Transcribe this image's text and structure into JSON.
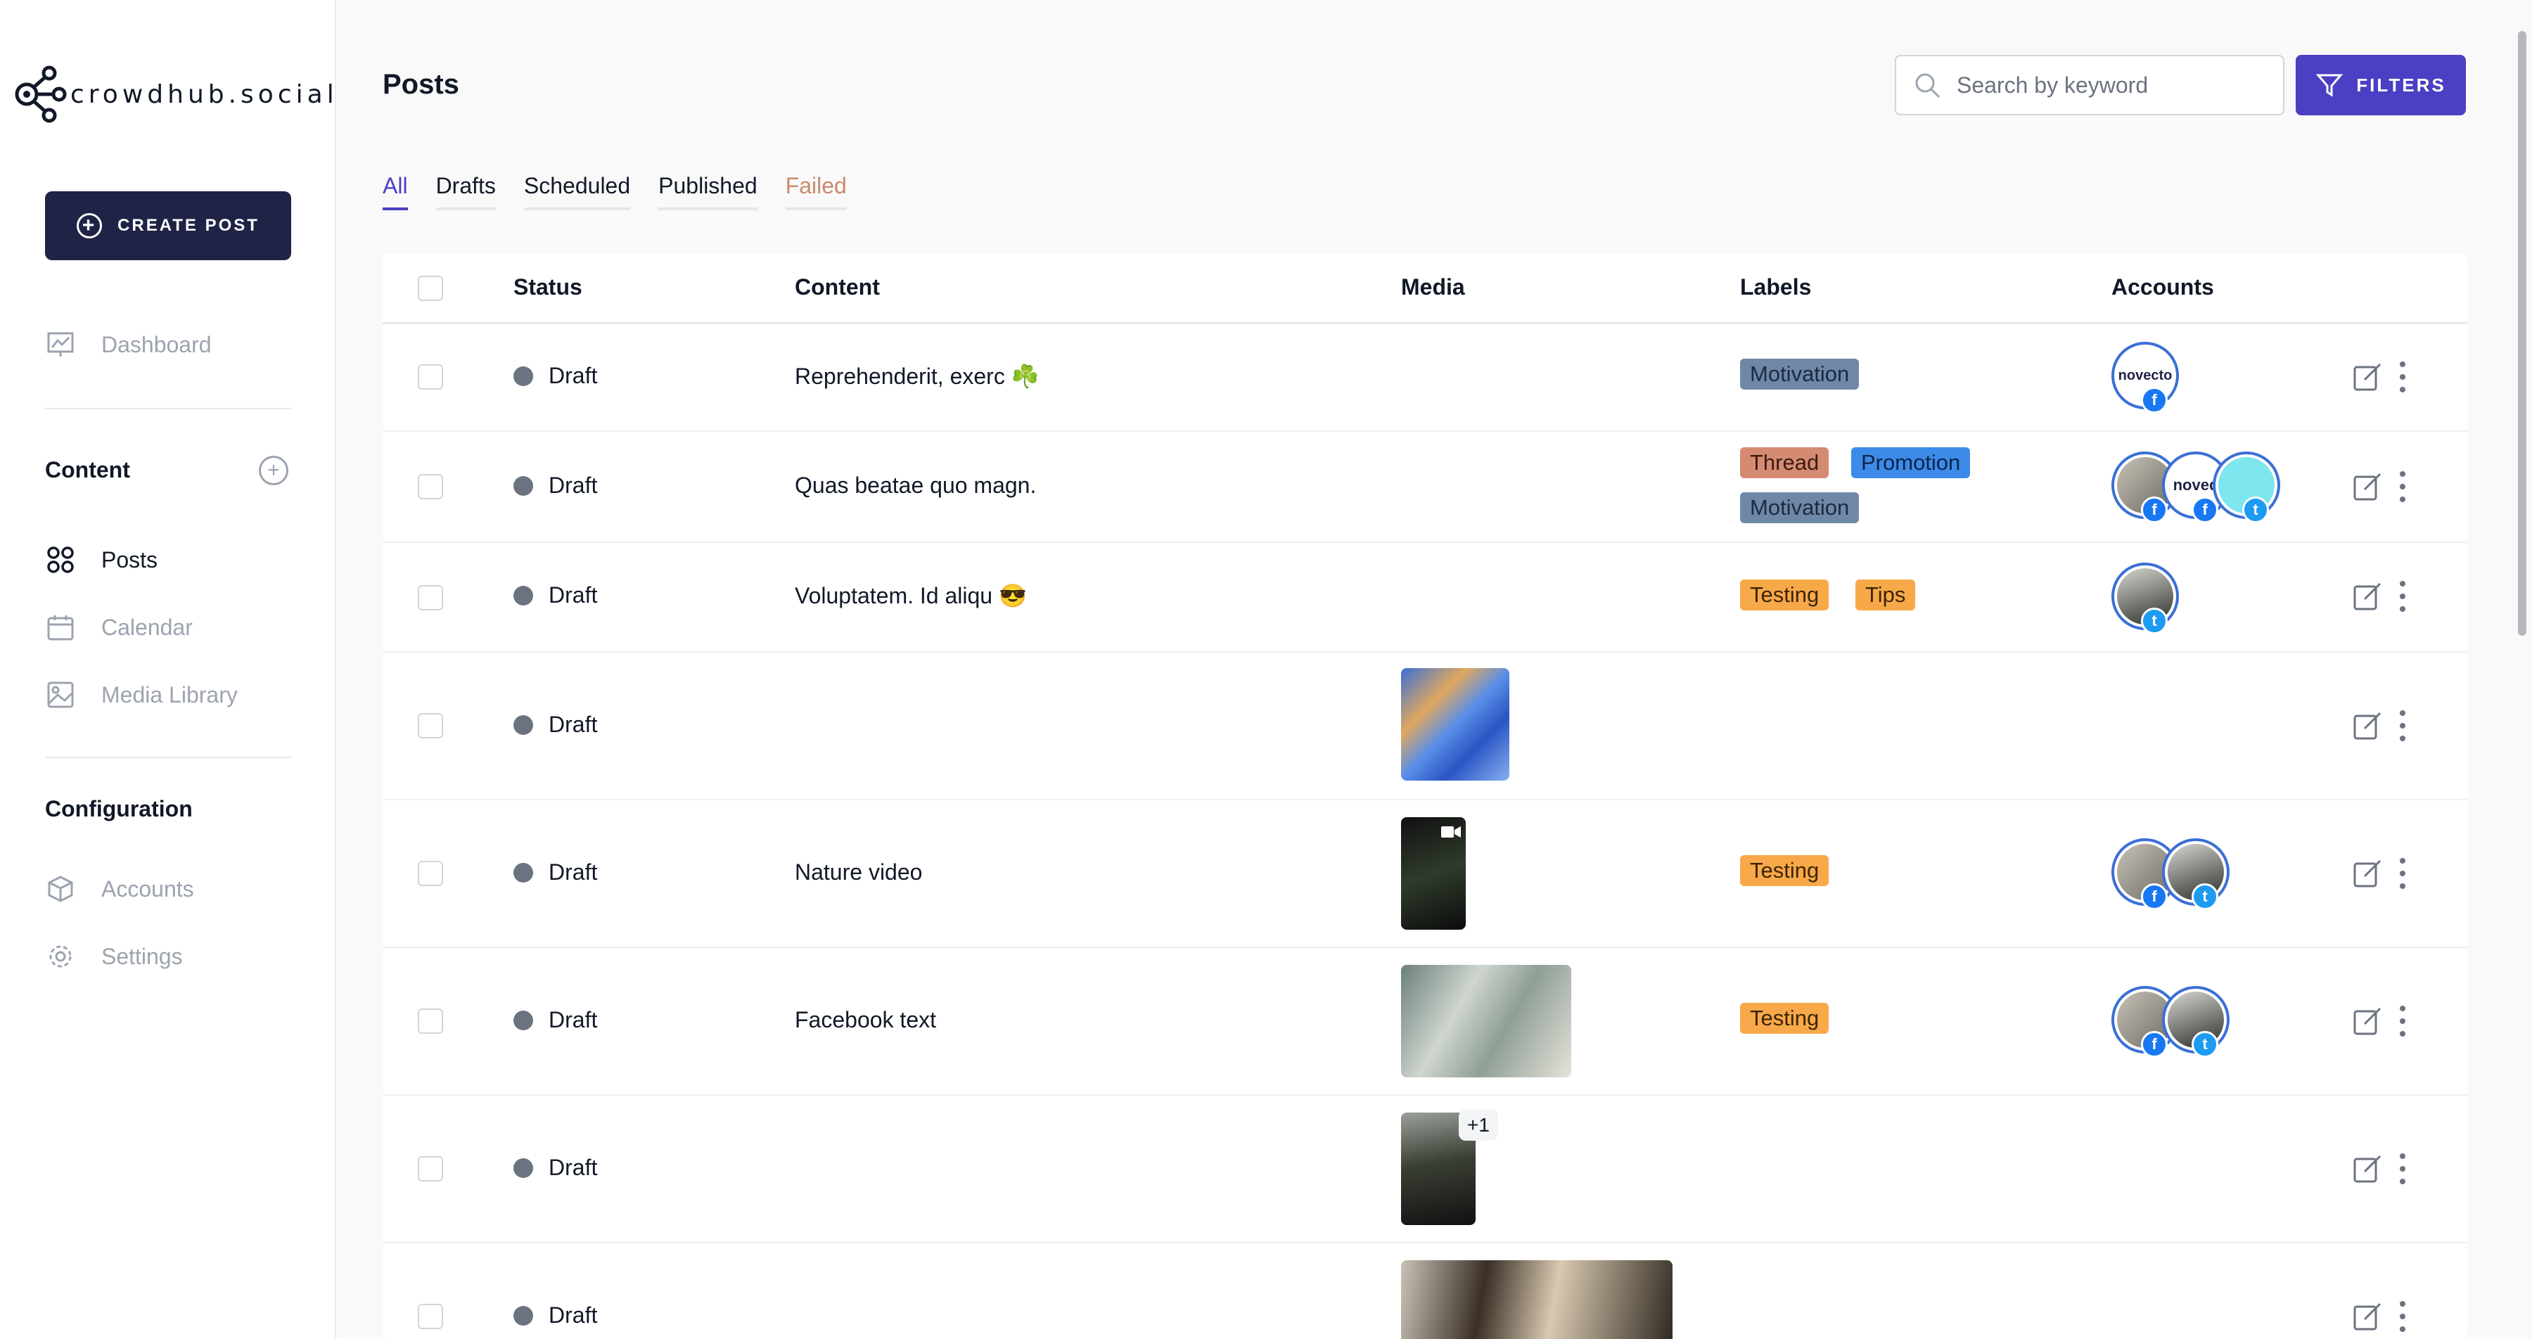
{
  "brand": {
    "name": "crowdhub.social"
  },
  "sidebar": {
    "create_label": "CREATE POST",
    "dashboard": "Dashboard",
    "content_title": "Content",
    "posts": "Posts",
    "calendar": "Calendar",
    "media_library": "Media Library",
    "config_title": "Configuration",
    "accounts": "Accounts",
    "settings": "Settings"
  },
  "header": {
    "title": "Posts",
    "search_placeholder": "Search by keyword",
    "filters_label": "FILTERS"
  },
  "tabs": [
    "All",
    "Drafts",
    "Scheduled",
    "Published",
    "Failed"
  ],
  "active_tab": "All",
  "table": {
    "columns": [
      "Status",
      "Content",
      "Media",
      "Labels",
      "Accounts"
    ],
    "rows": [
      {
        "status": "Draft",
        "content": "Reprehenderit, exerc ☘️",
        "media": [],
        "labels": [
          "Motivation"
        ],
        "accounts": [
          {
            "name": "novecto",
            "network": "facebook"
          }
        ]
      },
      {
        "status": "Draft",
        "content": "Quas beatae quo magn.",
        "media": [],
        "labels": [
          "Thread",
          "Promotion",
          "Motivation"
        ],
        "accounts": [
          {
            "name": "photo-man",
            "network": "facebook"
          },
          {
            "name": "noved",
            "network": "facebook"
          },
          {
            "name": "cyan-avatar",
            "network": "twitter"
          }
        ]
      },
      {
        "status": "Draft",
        "content": "Voluptatem. Id aliqu 😎",
        "media": [],
        "labels": [
          "Testing",
          "Tips"
        ],
        "accounts": [
          {
            "name": "bearded-man",
            "network": "twitter"
          }
        ]
      },
      {
        "status": "Draft",
        "content": "",
        "media": [
          "blue-marble-image"
        ],
        "labels": [],
        "accounts": []
      },
      {
        "status": "Draft",
        "content": "Nature video",
        "media": [
          "plant-video"
        ],
        "labels": [
          "Testing"
        ],
        "accounts": [
          {
            "name": "photo-man",
            "network": "facebook"
          },
          {
            "name": "bearded-man",
            "network": "twitter"
          }
        ]
      },
      {
        "status": "Draft",
        "content": "Facebook text",
        "media": [
          "people-table-image"
        ],
        "labels": [
          "Testing"
        ],
        "accounts": [
          {
            "name": "photo-man",
            "network": "facebook"
          },
          {
            "name": "bearded-man",
            "network": "twitter"
          }
        ]
      },
      {
        "status": "Draft",
        "content": "",
        "media": [
          "dark-portrait-image"
        ],
        "media_extra": "+1",
        "labels": [],
        "accounts": []
      },
      {
        "status": "Draft",
        "content": "",
        "media": [
          "warrior-scene-image"
        ],
        "labels": [],
        "accounts": []
      }
    ]
  },
  "avatar_texts": {
    "novecto": "novecto",
    "noved": "noved"
  },
  "colors": {
    "accent": "#4b3fc4",
    "nav_dark": "#1f2345",
    "facebook": "#1877f2",
    "twitter": "#1d9bf0"
  }
}
